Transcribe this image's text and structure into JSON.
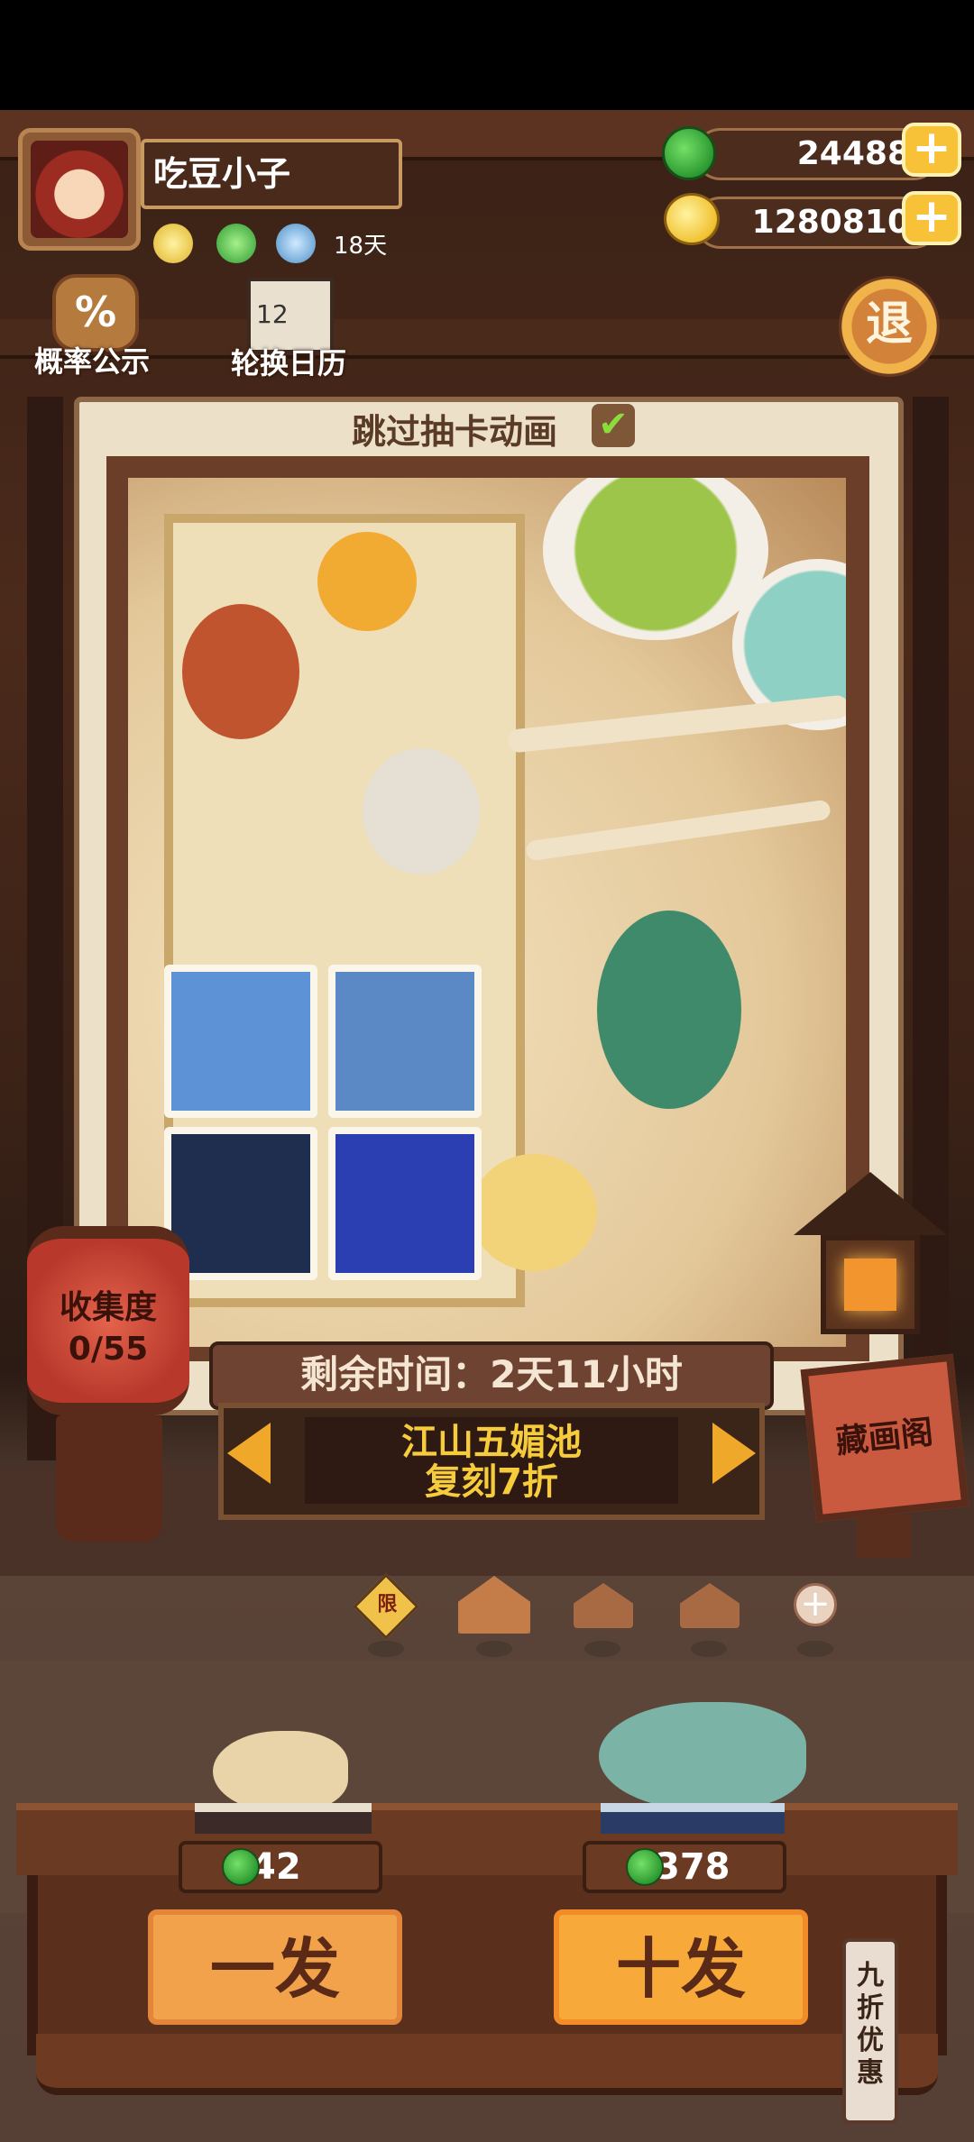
{
  "player": {
    "name": "吃豆小子",
    "days": "18天"
  },
  "resources": {
    "jade": "24488",
    "coins": "1280810"
  },
  "buttons": {
    "probability": "概率公示",
    "calendar": "轮换日历",
    "calendar_number": "12",
    "exit": "退",
    "collection_hall": "藏画阁"
  },
  "skip_animation": {
    "label": "跳过抽卡动画",
    "checked": true
  },
  "collection": {
    "label": "收集度",
    "progress": "0/55"
  },
  "pool": {
    "remaining_time": "剩余时间：2天11小时",
    "name_line1": "江山五媚池",
    "name_line2": "复刻7折"
  },
  "pool_tabs": {
    "limited_label": "限",
    "selected_index": 1,
    "count": 4
  },
  "draw": {
    "single_price": "42",
    "single_label": "一发",
    "ten_price": "378",
    "ten_label": "十发",
    "discount": "九折优惠"
  },
  "colors": {
    "accent_gold": "#f7c237",
    "jade_green": "#2d9a32",
    "wood": "#5b3320",
    "button_orange": "#f1a24a"
  }
}
